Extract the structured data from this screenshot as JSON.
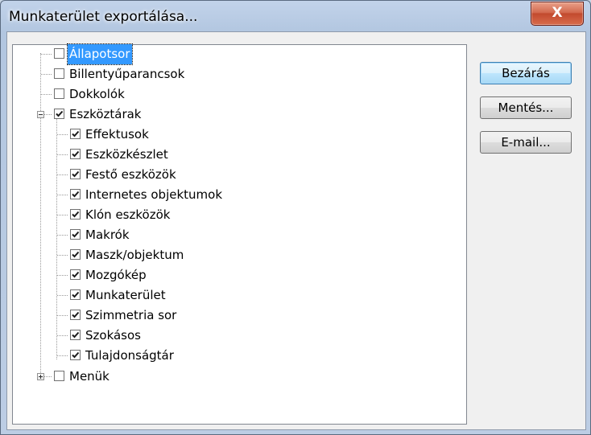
{
  "window": {
    "title": "Munkaterület exportálása...",
    "close_label": "X"
  },
  "buttons": {
    "close": "Bezárás",
    "save": "Mentés...",
    "email": "E-mail..."
  },
  "tree": {
    "top_items": [
      {
        "label": "Állapotsor",
        "checked": false,
        "selected": true
      },
      {
        "label": "Billentyűparancsok",
        "checked": false
      },
      {
        "label": "Dokkolók",
        "checked": false
      },
      {
        "label": "Eszköztárak",
        "checked": true,
        "expanded": true
      }
    ],
    "toolbar_children": [
      {
        "label": "Effektusok",
        "checked": true
      },
      {
        "label": "Eszközkészlet",
        "checked": true
      },
      {
        "label": "Festő eszközök",
        "checked": true
      },
      {
        "label": "Internetes objektumok",
        "checked": true
      },
      {
        "label": "Klón eszközök",
        "checked": true
      },
      {
        "label": "Makrók",
        "checked": true
      },
      {
        "label": "Maszk/objektum",
        "checked": true
      },
      {
        "label": "Mozgókép",
        "checked": true
      },
      {
        "label": "Munkaterület",
        "checked": true
      },
      {
        "label": "Szimmetria sor",
        "checked": true
      },
      {
        "label": "Szokásos",
        "checked": true
      },
      {
        "label": "Tulajdonságtár",
        "checked": true
      }
    ],
    "last_item": {
      "label": "Menük",
      "checked": false,
      "expanded": false
    }
  }
}
